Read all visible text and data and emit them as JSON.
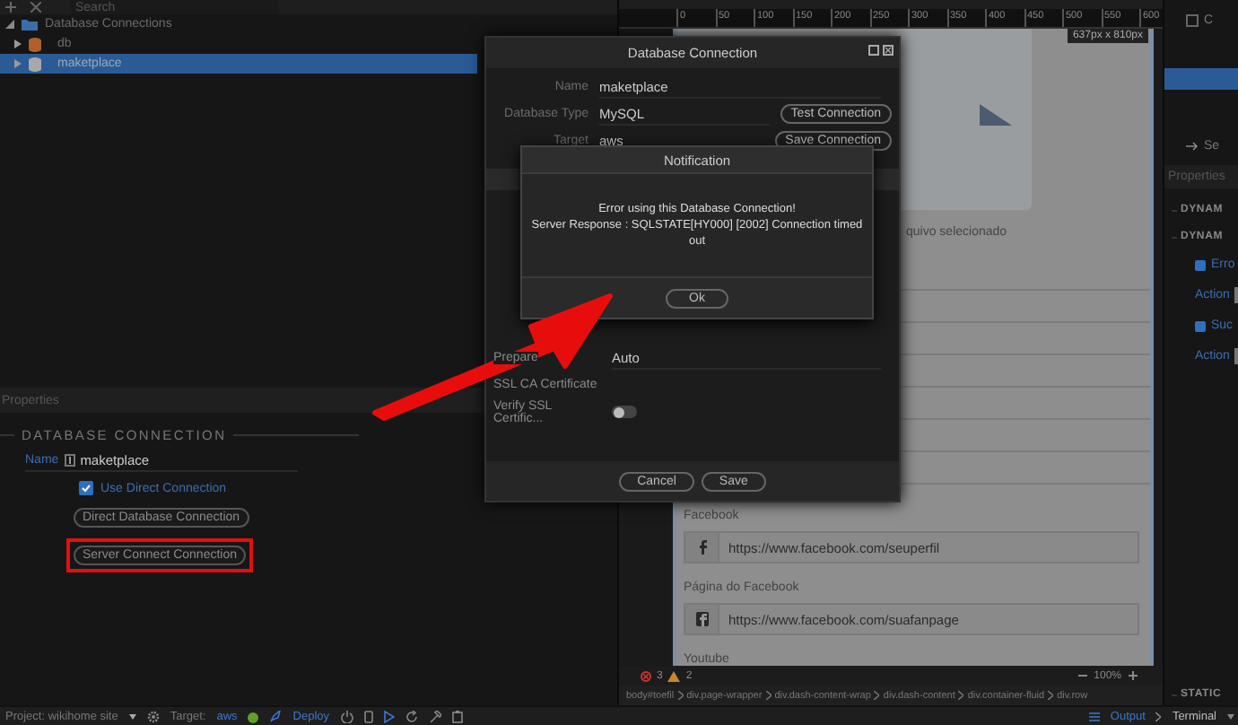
{
  "left_panel": {
    "search": {
      "placeholder": "Search"
    },
    "tree": [
      {
        "label": "Database Connections",
        "expanded": true,
        "children": [
          {
            "label": "db",
            "selected": false,
            "color": "#b0602a"
          },
          {
            "label": "maketplace",
            "selected": true,
            "color": "#a8a8a8"
          }
        ]
      }
    ]
  },
  "properties": {
    "title": "Properties",
    "section": "DATABASE CONNECTION",
    "name_label": "Name",
    "name_value": "maketplace",
    "use_direct": {
      "label": "Use Direct Connection",
      "checked": true
    },
    "buttons": [
      {
        "label": "Direct Database Connection",
        "highlighted": false
      },
      {
        "label": "Server Connect Connection",
        "highlighted": true
      }
    ]
  },
  "design_view": {
    "ruler_ticks": [
      "0",
      "50",
      "100",
      "150",
      "200",
      "250",
      "300",
      "350",
      "400",
      "450",
      "500",
      "550",
      "600"
    ],
    "size_badge": "637px x 810px",
    "partial_text": "quivo selecionado",
    "fields": [
      {
        "label": "Facebook",
        "value": "https://www.facebook.com/seuperfil"
      },
      {
        "label": "Página do Facebook",
        "value": "https://www.facebook.com/suafanpage"
      }
    ],
    "cut_label": "Youtube",
    "status": {
      "errors": "3",
      "warnings": "2",
      "zoom": "100%"
    },
    "breadcrumb": [
      "body#toefil",
      "div.page-wrapper",
      "div.dash-content-wrap",
      "div.dash-content",
      "div.container-fluid",
      "div.row"
    ]
  },
  "right_panel": {
    "tree": [
      {
        "label": "C",
        "checked": false
      },
      {
        "label": "Se"
      }
    ],
    "title": "Properties",
    "sections": [
      "DYNAM",
      "DYNAM"
    ],
    "checks": [
      {
        "label": "Erro",
        "checked": true,
        "action": "Action"
      },
      {
        "label": "Suc",
        "checked": true,
        "action": "Action"
      }
    ],
    "last_section": "STATIC"
  },
  "bottom_bar": {
    "project": "Project: wikihome site",
    "target_label": "Target:",
    "target": "aws",
    "deploy": "Deploy",
    "output": "Output",
    "terminal": "Terminal"
  },
  "db_dialog": {
    "title": "Database Connection",
    "fields": [
      {
        "label": "Name",
        "value": "maketplace"
      },
      {
        "label": "Database Type",
        "value": "MySQL",
        "button": "Test Connection"
      },
      {
        "label": "Target",
        "value": "aws",
        "button": "Save Connection"
      }
    ],
    "lower_fields": [
      {
        "kind": "text",
        "label": "Prepare",
        "value": "Auto"
      },
      {
        "kind": "text",
        "label": "SSL CA Certificate"
      },
      {
        "kind": "toggle",
        "label": "Verify SSL Certific...",
        "on": false
      }
    ],
    "footer_buttons": [
      "Cancel",
      "Save"
    ]
  },
  "notification": {
    "title": "Notification",
    "message": [
      "Error using this Database Connection!",
      "Server Response : SQLSTATE[HY000] [2002] Connection timed out"
    ],
    "button": "Ok"
  }
}
